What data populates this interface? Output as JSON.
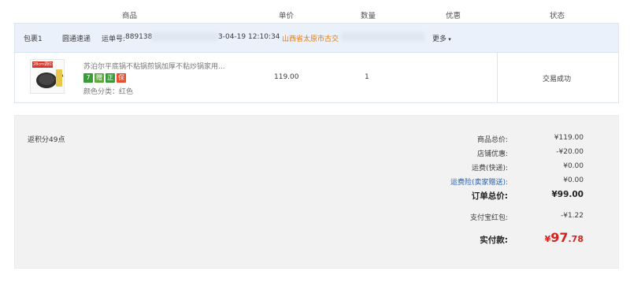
{
  "header": {
    "product": "商品",
    "unit_price": "单价",
    "quantity": "数量",
    "discount": "优惠",
    "status": "状态"
  },
  "package": {
    "label": "包裹1",
    "carrier": "圆通速递",
    "tracking_label": "运单号:",
    "tracking_number_visible": "889138",
    "date_partial": "3-04-19 12:10:34",
    "address_partial": "山西省太原市古交",
    "more": "更多"
  },
  "item": {
    "thumb_text": "28cm调红色",
    "title": "苏泊尔平底锅不粘锅煎锅加厚不粘炒锅家用...",
    "tags": [
      {
        "text": "7",
        "color": "#3a9a3a"
      },
      {
        "text": "赠",
        "color": "#5fa83c"
      },
      {
        "text": "正",
        "color": "#3a9a3a"
      },
      {
        "text": "保",
        "color": "#e6502e"
      }
    ],
    "variant": "颜色分类：红色",
    "price": "119.00",
    "quantity": "1",
    "status": "交易成功"
  },
  "summary": {
    "points": "返积分49点",
    "goods_total_label": "商品总价:",
    "goods_total": "¥119.00",
    "store_discount_label": "店铺优惠:",
    "store_discount": "-¥20.00",
    "shipping_label": "运费(快递):",
    "shipping": "¥0.00",
    "insurance_label": "运费险(卖家赠送):",
    "insurance": "¥0.00",
    "order_total_label": "订单总价:",
    "order_total": "¥99.00",
    "alipay_label": "支付宝红包:",
    "alipay": "-¥1.22",
    "paid_label": "实付款:",
    "paid_currency": "¥",
    "paid_main": "97",
    "paid_decimal": ".78"
  },
  "colors": {
    "accent_orange": "#e07a12",
    "price_red": "#d2231f",
    "link_blue": "#2a5fb0"
  }
}
